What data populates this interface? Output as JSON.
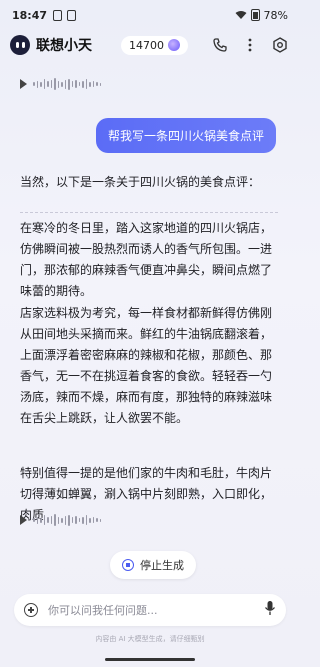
{
  "status_bar": {
    "time": "18:47",
    "battery": "78%"
  },
  "header": {
    "title": "联想小天",
    "points": "14700"
  },
  "user_message": "帮我写一条四川火锅美食点评",
  "reply": {
    "intro": "当然，以下是一条关于四川火锅的美食点评：",
    "paragraphs": [
      "在寒冷的冬日里，踏入这家地道的四川火锅店，仿佛瞬间被一股热烈而诱人的香气所包围。一进门，那浓郁的麻辣香气便直冲鼻尖，瞬间点燃了味蕾的期待。",
      "店家选料极为考究，每一样食材都新鲜得仿佛刚从田间地头采摘而来。鲜红的牛油锅底翻滚着，上面漂浮着密密麻麻的辣椒和花椒，那颜色、那香气，无一不在挑逗着食客的食欲。轻轻吞一勺汤底，辣而不燥，麻而有度，那独特的麻辣滋味在舌尖上跳跃，让人欲罢不能。",
      "特别值得一提的是他们家的牛肉和毛肚，牛肉片切得薄如蝉翼，涮入锅中片刻即熟，入口即化，肉质"
    ]
  },
  "stop_button": "停止生成",
  "input": {
    "placeholder": "你可以问我任何问题..."
  },
  "disclaimer": "内容由 AI 大模型生成，请仔细甄别"
}
